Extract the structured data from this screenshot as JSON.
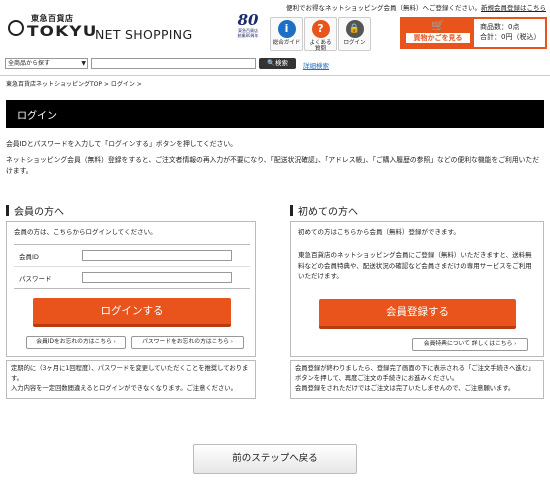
{
  "header": {
    "notice_prefix": "便利でお得なネットショッピング会員（無料）へご登録ください。",
    "notice_link": "新規会員登録はこちら",
    "logo_kanji": "東急百貨店",
    "logo_tokyu": "TOKYU",
    "logo_ns": "NET SHOPPING",
    "anniv_num": "80",
    "anniv_sub": "東急百貨店\n創業80周年",
    "buttons": [
      {
        "label": "総合ガイド",
        "icon": "info-icon",
        "glyph": "i"
      },
      {
        "label": "よくある\n質問",
        "icon": "question-icon",
        "glyph": "?"
      },
      {
        "label": "ログイン",
        "icon": "lock-icon",
        "glyph": "🔒"
      }
    ],
    "cart_label": "買物かごを見る",
    "cart_count": "商品数：0点",
    "cart_total": "合計：0円（税込）"
  },
  "search": {
    "category": "全商品から探す",
    "button": "検索",
    "advanced": "詳細検索"
  },
  "breadcrumb": "東急百貨店ネットショッピングTOP > ログイン >",
  "page_title": "ログイン",
  "desc1": "会員IDとパスワードを入力して「ログインする」ボタンを押してください。",
  "desc2": "ネットショッピング会員（無料）登録をすると、ご注文者情報の再入力が不要になり、「配送状況確認」、「アドレス帳」、「ご購入履歴の参照」などの便利な機能をご利用いただけます。",
  "member": {
    "heading": "会員の方へ",
    "intro": "会員の方は、こちらからログインしてください。",
    "id_label": "会員ID",
    "pw_label": "パスワード",
    "login_button": "ログインする",
    "forgot_id": "会員IDをお忘れの方はこちら",
    "forgot_pw": "パスワードをお忘れの方はこちら",
    "notice1": "定期的に（3ヶ月に1回程度）、パスワードを変更していただくことを推奨しております。",
    "notice2": "入力内容を一定回数間違えるとログインができなくなります。ご注意ください。"
  },
  "newbie": {
    "heading": "初めての方へ",
    "intro": "初めての方はこちらから会員（無料）登録ができます。",
    "body": "東急百貨店のネットショッピング会員にご登録（無料）いただきますと、送料無料などの会員特典や、配送状況の確認など会員さまだけの専用サービスをご利用いただけます。",
    "register_button": "会員登録する",
    "perks_button": "会員特典について 詳しくはこちら",
    "notice1": "会員登録が終わりましたら、登録完了画面の下に表示される「ご注文手続きへ進む」ボタンを押して、再度ご注文の手続きにお進みください。",
    "notice2": "会員登録をされただけではご注文は完了いたしませんので、ご注意願います。"
  },
  "back_button": "前のステップへ戻る"
}
